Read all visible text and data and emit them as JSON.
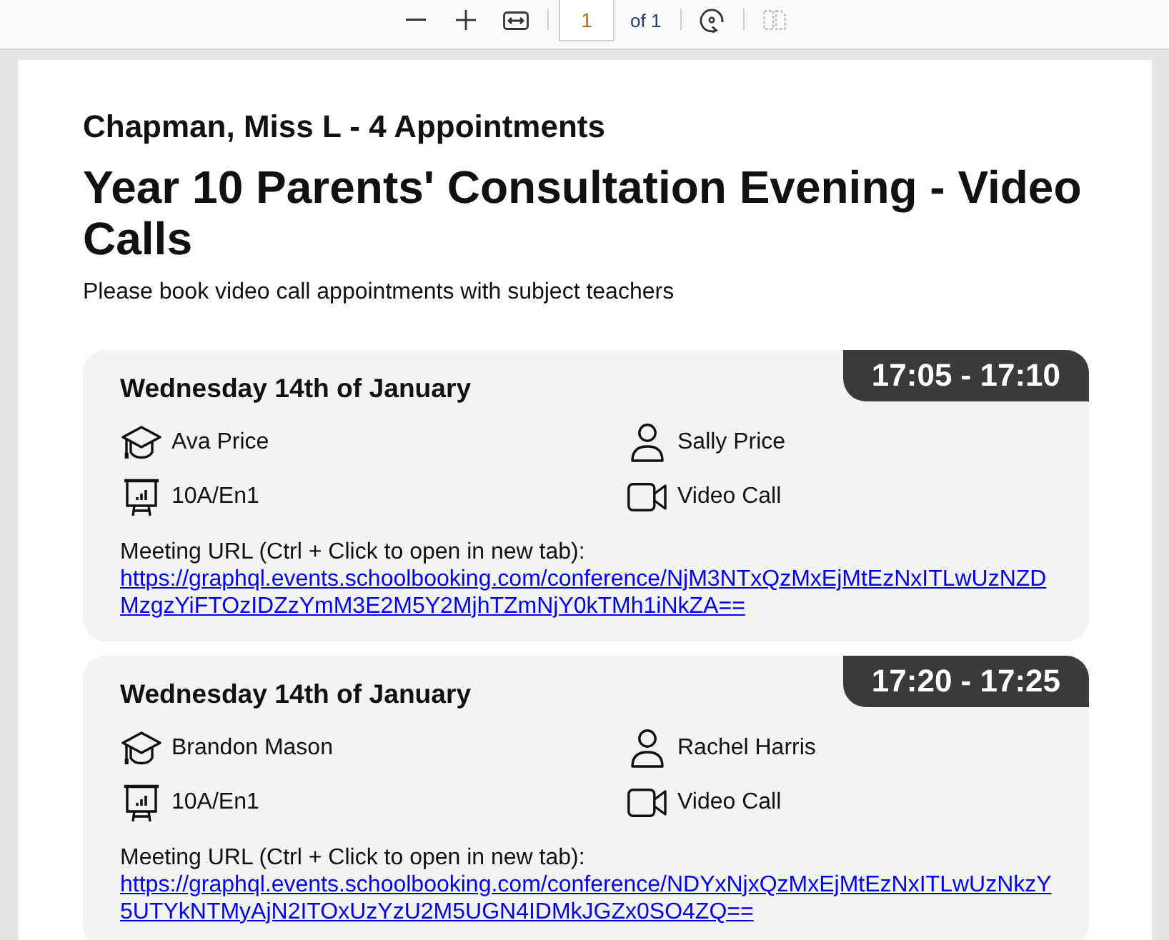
{
  "toolbar": {
    "zoom_buttons": [
      {
        "kind": "zoom-out",
        "disabled": false
      },
      {
        "kind": "zoom-in",
        "disabled": false
      },
      {
        "kind": "fit-width",
        "disabled": false
      }
    ],
    "page_field": {
      "value": "1"
    },
    "page_count": "of 1",
    "view_buttons": [
      {
        "kind": "rotate",
        "disabled": false
      },
      {
        "kind": "two-page",
        "disabled": true
      }
    ]
  },
  "document": {
    "heading": "Chapman, Miss L - 4 Appointments",
    "title": "Year 10 Parents' Consultation Evening - Video Calls",
    "subtitle": "Please book video call appointments with subject teachers",
    "appointments": [
      {
        "time": "17:05 - 17:10",
        "date": "Wednesday 14th of January",
        "student": "Ava Price",
        "teacher": "Sally Price",
        "class": "10A/En1",
        "method": "Video Call",
        "url_label": "Meeting URL (Ctrl + Click to open in new tab):",
        "url": "https://graphql.events.schoolbooking.com/conference/NjM3NTxQzMxEjMtEzNxITLwUzNZDMzgzYiFTOzIDZzYmM3E2M5Y2MjhTZmNjY0kTMh1iNkZA=="
      },
      {
        "time": "17:20 - 17:25",
        "date": "Wednesday 14th of January",
        "student": "Brandon Mason",
        "teacher": "Rachel Harris",
        "class": "10A/En1",
        "method": "Video Call",
        "url_label": "Meeting URL (Ctrl + Click to open in new tab):",
        "url": "https://graphql.events.schoolbooking.com/conference/NDYxNjxQzMxEjMtEzNxITLwUzNkzY5UTYkNTMyAjN2ITOxUzYzU2M5UGN4IDMkJGZx0SO4ZQ=="
      }
    ]
  }
}
